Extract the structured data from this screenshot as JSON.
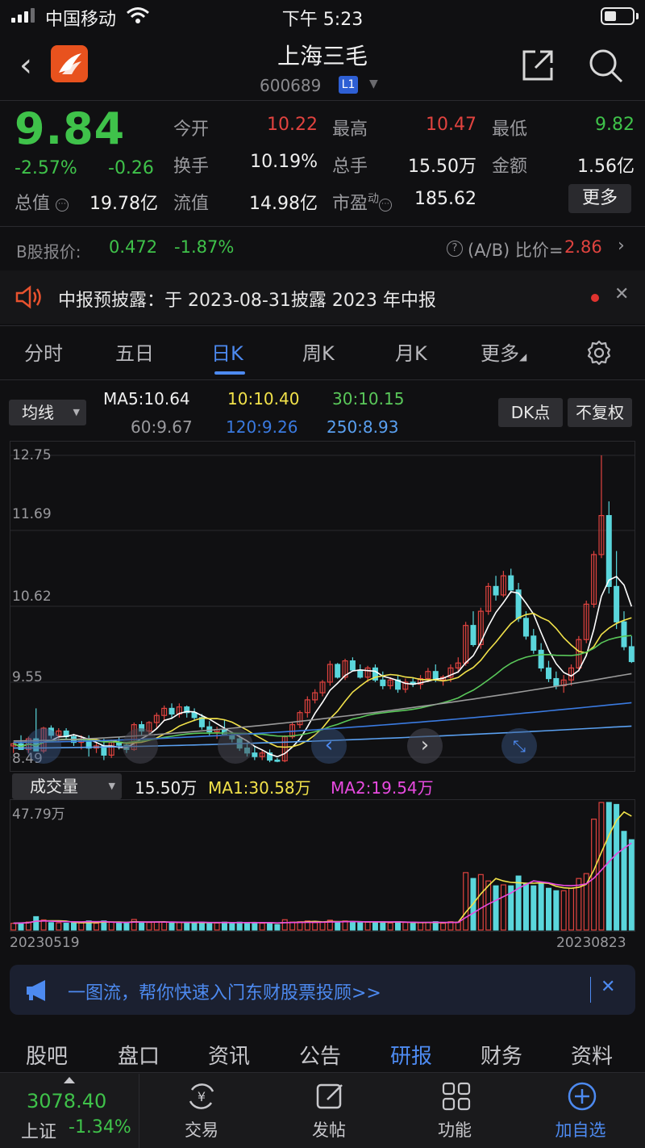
{
  "status_bar": {
    "carrier": "中国移动",
    "time": "下午 5:23"
  },
  "header": {
    "title": "上海三毛",
    "code": "600689",
    "level_badge": "L1"
  },
  "quote": {
    "price": "9.84",
    "change_pct": "-2.57%",
    "change_val": "-0.26",
    "open_label": "今开",
    "open": "10.22",
    "high_label": "最高",
    "high": "10.47",
    "low_label": "最低",
    "low": "9.82",
    "turnover_label": "换手",
    "turnover": "10.19%",
    "volume_label": "总手",
    "volume": "15.50万",
    "amount_label": "金额",
    "amount": "1.56亿",
    "mktcap_label": "总值",
    "mktcap": "19.78亿",
    "float_label": "流值",
    "float": "14.98亿",
    "pe_label": "市盈",
    "pe_sup": "动",
    "pe": "185.62",
    "more_label": "更多"
  },
  "bshare": {
    "label": "B股报价:",
    "price": "0.472",
    "change": "-1.87%",
    "ratio_label": "(A/B) 比价=",
    "ratio": "2.86"
  },
  "notice": {
    "text": "中报预披露：于 2023-08-31披露 2023 年中报"
  },
  "tabs": [
    {
      "label": "分时"
    },
    {
      "label": "五日"
    },
    {
      "label": "日K"
    },
    {
      "label": "周K"
    },
    {
      "label": "月K"
    },
    {
      "label": "更多"
    }
  ],
  "ma_row": {
    "dropdown": "均线",
    "ma5": "MA5:10.64",
    "ma10": "10:10.40",
    "ma30": "30:10.15",
    "ma60": "60:9.67",
    "ma120": "120:9.26",
    "ma250": "250:8.93",
    "dk_label": "DK点",
    "fq_label": "不复权"
  },
  "colors": {
    "up": "#e0433f",
    "down": "#5ad6dc",
    "ma5": "#ffffff",
    "ma10": "#f2e24a",
    "ma30": "#5ac85a",
    "ma60": "#9a9a9a",
    "ma120": "#3a7ae0",
    "ma250": "#5aa0f0",
    "vol_ma1": "#f2e24a",
    "vol_ma2": "#e84ae0",
    "accent": "#4d8af0"
  },
  "chart_data": {
    "type": "candlestick",
    "y_ticks": [
      "12.75",
      "11.69",
      "10.62",
      "9.55",
      "8.49"
    ],
    "ylim": [
      8.49,
      12.75
    ],
    "candles": [
      [
        8.65,
        8.7,
        8.55,
        8.68
      ],
      [
        8.68,
        8.8,
        8.62,
        8.6
      ],
      [
        8.6,
        8.78,
        8.55,
        8.75
      ],
      [
        8.75,
        9.18,
        8.6,
        8.58
      ],
      [
        8.58,
        8.92,
        8.55,
        8.9
      ],
      [
        8.9,
        8.94,
        8.75,
        8.8
      ],
      [
        8.8,
        8.9,
        8.72,
        8.86
      ],
      [
        8.86,
        8.9,
        8.75,
        8.78
      ],
      [
        8.78,
        8.82,
        8.65,
        8.7
      ],
      [
        8.7,
        8.8,
        8.6,
        8.75
      ],
      [
        8.75,
        8.8,
        8.5,
        8.62
      ],
      [
        8.62,
        8.7,
        8.55,
        8.65
      ],
      [
        8.65,
        8.75,
        8.45,
        8.52
      ],
      [
        8.52,
        8.72,
        8.48,
        8.7
      ],
      [
        8.7,
        8.78,
        8.6,
        8.66
      ],
      [
        8.66,
        8.7,
        8.55,
        8.6
      ],
      [
        8.6,
        8.98,
        8.58,
        8.95
      ],
      [
        8.95,
        9.0,
        8.8,
        8.86
      ],
      [
        8.86,
        9.0,
        8.8,
        8.98
      ],
      [
        8.98,
        9.12,
        8.9,
        9.08
      ],
      [
        9.08,
        9.22,
        9.0,
        9.18
      ],
      [
        9.18,
        9.25,
        9.05,
        9.1
      ],
      [
        9.1,
        9.25,
        9.05,
        9.2
      ],
      [
        9.2,
        9.22,
        9.05,
        9.12
      ],
      [
        9.12,
        9.18,
        9.0,
        9.05
      ],
      [
        9.05,
        9.1,
        8.88,
        8.92
      ],
      [
        8.92,
        9.0,
        8.8,
        8.85
      ],
      [
        8.85,
        8.92,
        8.75,
        8.88
      ],
      [
        8.88,
        9.02,
        8.8,
        8.8
      ],
      [
        8.8,
        8.85,
        8.7,
        8.75
      ],
      [
        8.75,
        8.8,
        8.58,
        8.62
      ],
      [
        8.62,
        8.7,
        8.5,
        8.55
      ],
      [
        8.55,
        8.65,
        8.45,
        8.5
      ],
      [
        8.5,
        8.6,
        8.45,
        8.55
      ],
      [
        8.55,
        8.6,
        8.42,
        8.45
      ],
      [
        8.45,
        8.48,
        8.42,
        8.44
      ],
      [
        8.44,
        8.8,
        8.42,
        8.78
      ],
      [
        8.78,
        8.98,
        8.75,
        8.95
      ],
      [
        8.95,
        9.15,
        8.9,
        9.12
      ],
      [
        9.12,
        9.35,
        9.05,
        9.3
      ],
      [
        9.3,
        9.45,
        9.25,
        9.4
      ],
      [
        9.4,
        9.58,
        9.35,
        9.55
      ],
      [
        9.55,
        9.85,
        9.5,
        9.8
      ],
      [
        9.8,
        9.82,
        9.6,
        9.62
      ],
      [
        9.62,
        9.88,
        9.58,
        9.85
      ],
      [
        9.85,
        9.9,
        9.7,
        9.72
      ],
      [
        9.72,
        9.8,
        9.6,
        9.62
      ],
      [
        9.62,
        9.78,
        9.55,
        9.75
      ],
      [
        9.75,
        9.8,
        9.55,
        9.58
      ],
      [
        9.58,
        9.7,
        9.45,
        9.5
      ],
      [
        9.5,
        9.62,
        9.45,
        9.58
      ],
      [
        9.58,
        9.65,
        9.4,
        9.45
      ],
      [
        9.45,
        9.6,
        9.4,
        9.55
      ],
      [
        9.55,
        9.62,
        9.48,
        9.52
      ],
      [
        9.52,
        9.65,
        9.45,
        9.6
      ],
      [
        9.6,
        9.75,
        9.55,
        9.7
      ],
      [
        9.7,
        9.8,
        9.55,
        9.58
      ],
      [
        9.58,
        9.65,
        9.5,
        9.62
      ],
      [
        9.62,
        9.8,
        9.55,
        9.75
      ],
      [
        9.75,
        9.9,
        9.68,
        9.82
      ],
      [
        9.82,
        10.4,
        9.78,
        10.35
      ],
      [
        10.35,
        10.55,
        10.05,
        10.08
      ],
      [
        10.08,
        10.6,
        10.02,
        10.55
      ],
      [
        10.55,
        10.95,
        10.5,
        10.9
      ],
      [
        10.9,
        11.05,
        10.7,
        10.78
      ],
      [
        10.78,
        11.12,
        10.75,
        11.05
      ],
      [
        11.05,
        11.15,
        10.8,
        10.85
      ],
      [
        10.85,
        10.95,
        10.4,
        10.45
      ],
      [
        10.45,
        10.55,
        10.15,
        10.2
      ],
      [
        10.2,
        10.3,
        9.95,
        10.0
      ],
      [
        10.0,
        10.1,
        9.7,
        9.75
      ],
      [
        9.75,
        9.85,
        9.55,
        9.6
      ],
      [
        9.6,
        9.7,
        9.45,
        9.5
      ],
      [
        9.5,
        9.65,
        9.4,
        9.58
      ],
      [
        9.58,
        9.8,
        9.5,
        9.75
      ],
      [
        9.75,
        10.2,
        9.7,
        10.15
      ],
      [
        10.15,
        10.7,
        10.1,
        10.65
      ],
      [
        10.65,
        11.4,
        10.6,
        11.35
      ],
      [
        11.35,
        12.75,
        11.3,
        11.9
      ],
      [
        11.9,
        12.1,
        10.8,
        10.9
      ],
      [
        10.9,
        11.4,
        10.3,
        10.4
      ],
      [
        10.4,
        10.55,
        10.0,
        10.05
      ],
      [
        10.05,
        10.2,
        9.82,
        9.84
      ]
    ],
    "volume_max_label": "47.79万",
    "date_start": "20230519",
    "date_end": "20230823"
  },
  "volume_row": {
    "dropdown": "成交量",
    "value": "15.50万",
    "ma1": "MA1:30.58万",
    "ma2": "MA2:19.54万"
  },
  "promo": {
    "text": "一图流，帮你快速入门东财股票投顾>>"
  },
  "sub_tabs": [
    {
      "label": "股吧"
    },
    {
      "label": "盘口"
    },
    {
      "label": "资讯"
    },
    {
      "label": "公告"
    },
    {
      "label": "研报"
    },
    {
      "label": "财务"
    },
    {
      "label": "资料"
    }
  ],
  "bottom_nav": {
    "index_value": "3078.40",
    "index_name": "上证",
    "index_change": "-1.34%",
    "items": [
      {
        "label": "交易"
      },
      {
        "label": "发帖"
      },
      {
        "label": "功能"
      },
      {
        "label": "加自选"
      }
    ]
  }
}
